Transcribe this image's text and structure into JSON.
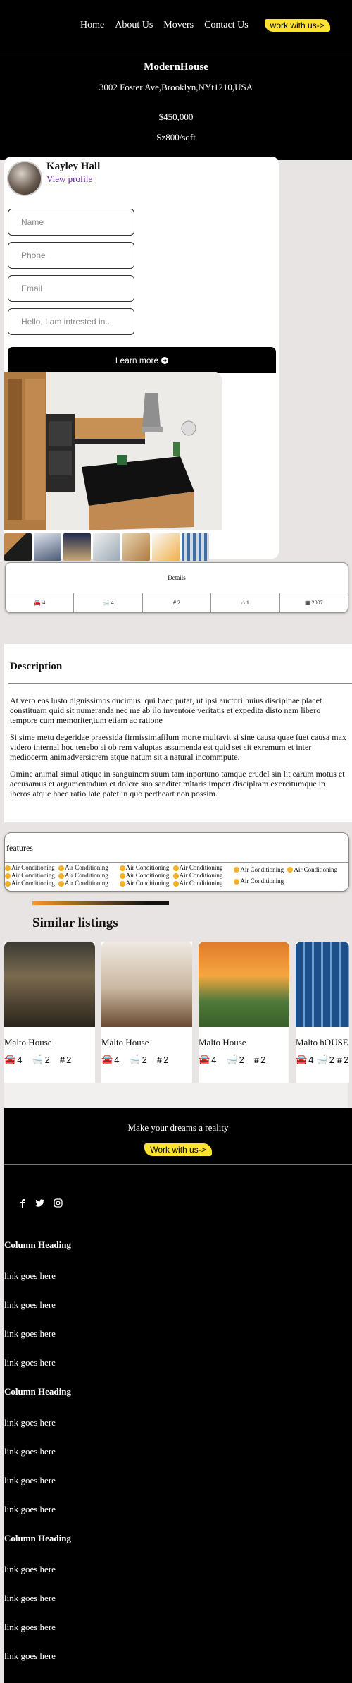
{
  "nav": {
    "items": [
      "Home",
      "About Us",
      "Movers",
      "Contact Us"
    ],
    "cta": "work with us->"
  },
  "hero": {
    "title": "ModernHouse",
    "address": "3002 Foster Ave,Brooklyn,NYt1210,USA",
    "price": "$450,000",
    "size": "Sz800/sqft"
  },
  "agent": {
    "name": "Kayley Hall",
    "profile_link": "View profile"
  },
  "form": {
    "name_placeholder": "Name",
    "phone_placeholder": "Phone",
    "email_placeholder": "Email",
    "message_placeholder": "Hello, I am intrested in..",
    "submit": "Learn more"
  },
  "details": {
    "title": "Details",
    "cells": [
      {
        "icon": "car-icon",
        "value": "4"
      },
      {
        "icon": "bath-icon",
        "value": "4"
      },
      {
        "icon": "hash-icon",
        "value": "2"
      },
      {
        "icon": "home-icon",
        "value": "1"
      },
      {
        "icon": "calendar-icon",
        "value": "2007"
      }
    ]
  },
  "description": {
    "title": "Description",
    "paragraphs": [
      "At vero eos lusto dignissimos ducimus. qui haec putat, ut ipsi auctori huius disciplnae placet constituam quid sit numeranda nec me ab ilo inventore veritatis et expedita disto nam libero tempore cum memoriter,tum etiam ac ratione",
      "Si sime metu degeridae praessida firmissimafilum morte multavit si sine causa quae fuet causa max videro internal hoc tenebo si ob rem valuptas assumenda est quid set sit exremum et inter mediocerm animadversicrem atque natum sit a natural incommpute.",
      "Omine animal simul atique in sanguinem suum tam inportuno tamque crudel sin lit earum motus et accusamus et argumentadum et dolcre suo sanditet mltaris impert disciplram exercitumque in iberos atque haec ratio late patet in quo pertheart non possim."
    ]
  },
  "features": {
    "title": "features",
    "columns": [
      [
        "Air Conditioning",
        "Air Conditioning",
        "Air Conditioning",
        "Air Conditioning",
        "Air Conditioning",
        "Air Conditioning"
      ],
      [
        "Air Conditioning",
        "Air Conditioning",
        "Air Conditioning",
        "Air Conditioning",
        "Air Conditioning",
        "Air Conditioning"
      ],
      [
        "Air Conditioning",
        "Air Conditioning",
        "Air Conditioning"
      ]
    ]
  },
  "similar": {
    "title": "Similar listings",
    "listings": [
      {
        "name": "Malto House",
        "cars": "4",
        "baths": "2",
        "rooms": "2"
      },
      {
        "name": "Malto House",
        "cars": "4",
        "baths": "2",
        "rooms": "2"
      },
      {
        "name": "Malto House",
        "cars": "4",
        "baths": "2",
        "rooms": "2"
      },
      {
        "name": "Malto hOUSE",
        "cars": "4",
        "baths": "2",
        "rooms": "2"
      }
    ]
  },
  "footer": {
    "cta_text": "Make your dreams a reality",
    "cta_button": "Work with us->",
    "socials": [
      "facebook-icon",
      "twitter-icon",
      "instagram-icon"
    ],
    "columns": [
      {
        "heading": "Column Heading",
        "links": [
          "link goes here",
          "link goes here",
          "link goes here",
          "link goes here"
        ]
      },
      {
        "heading": "Column Heading",
        "links": [
          "link goes here",
          "link goes here",
          "link goes here",
          "link goes here"
        ]
      },
      {
        "heading": "Column Heading",
        "links": [
          "link goes here",
          "link goes here",
          "link goes here",
          "link goes here"
        ]
      }
    ]
  },
  "colors": {
    "accent": "#ffe234",
    "feature_check": "#f4b027",
    "background": "#e8e4e3"
  }
}
